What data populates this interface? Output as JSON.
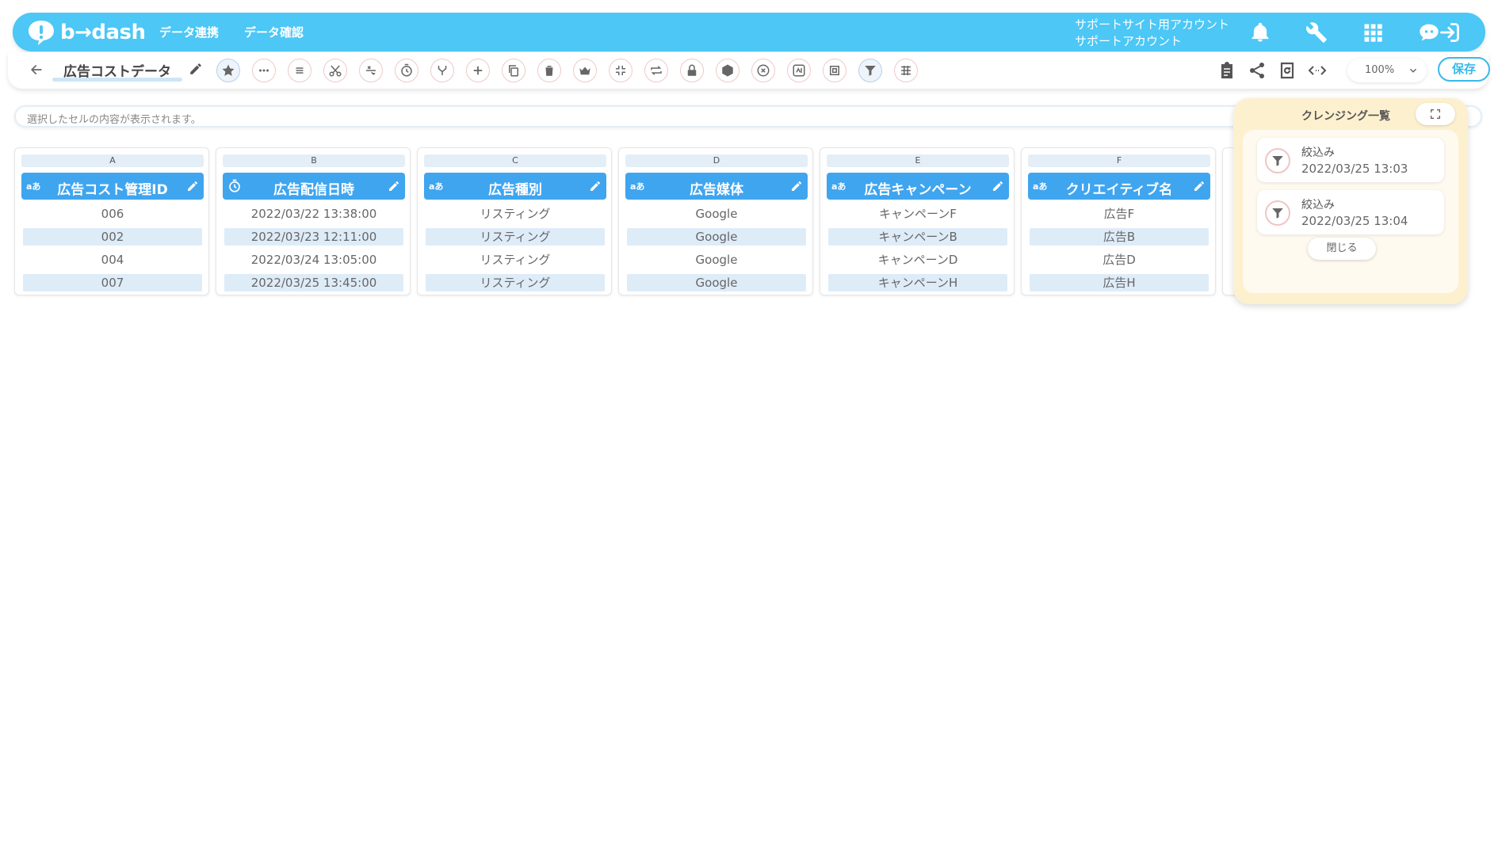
{
  "app": {
    "logo_text": "b→dash"
  },
  "header": {
    "nav": [
      {
        "label": "データ連携"
      },
      {
        "label": "データ確認"
      }
    ],
    "account_line1": "サポートサイト用アカウント",
    "account_line2": "サポートアカウント",
    "icons": [
      "bell-icon",
      "wrench-icon",
      "apps-grid-icon",
      "chat-icon",
      "logout-icon"
    ]
  },
  "toolbar": {
    "data_title": "広告コストデータ",
    "tools": [
      "star-icon",
      "ellipsis-icon",
      "list-icon",
      "scissors-icon",
      "formula-icon",
      "timer-icon",
      "merge-icon",
      "plus-icon",
      "copy-icon",
      "trash-icon",
      "crown-icon",
      "collapse-icon",
      "repeat-icon",
      "lock-icon",
      "package-icon",
      "cancel-icon",
      "replace-icon",
      "id-icon",
      "filter-icon",
      "pivot-icon"
    ],
    "right_icons": [
      "clipboard-icon",
      "share-icon",
      "refresh-icon",
      "code-icon"
    ],
    "zoom": "100%",
    "save_label": "保存"
  },
  "cellbar": {
    "placeholder": "選択したセルの内容が表示されます。"
  },
  "columns": [
    {
      "letter": "A",
      "type": "aあ",
      "name": "広告コスト管理ID",
      "cells": [
        "006",
        "002",
        "004",
        "007"
      ]
    },
    {
      "letter": "B",
      "type": "time",
      "name": "広告配信日時",
      "cells": [
        "2022/03/22 13:38:00",
        "2022/03/23 12:11:00",
        "2022/03/24 13:05:00",
        "2022/03/25 13:45:00"
      ]
    },
    {
      "letter": "C",
      "type": "aあ",
      "name": "広告種別",
      "cells": [
        "リスティング",
        "リスティング",
        "リスティング",
        "リスティング"
      ]
    },
    {
      "letter": "D",
      "type": "aあ",
      "name": "広告媒体",
      "cells": [
        "Google",
        "Google",
        "Google",
        "Google"
      ]
    },
    {
      "letter": "E",
      "type": "aあ",
      "name": "広告キャンペーン",
      "cells": [
        "キャンペーンF",
        "キャンペーンB",
        "キャンペーンD",
        "キャンペーンH"
      ]
    },
    {
      "letter": "F",
      "type": "aあ",
      "name": "クリエイティブ名",
      "cells": [
        "広告F",
        "広告B",
        "広告D",
        "広告H"
      ]
    }
  ],
  "cleansing_panel": {
    "title": "クレンジング一覧",
    "items": [
      {
        "label": "絞込み",
        "time": "2022/03/25 13:03"
      },
      {
        "label": "絞込み",
        "time": "2022/03/25 13:04"
      }
    ],
    "close_label": "閉じる"
  },
  "colors": {
    "header_bg": "#4cc7f6",
    "column_header": "#3fa5ef",
    "row_alt": "#deecf8",
    "panel_bg": "#fdf0cf",
    "accent": "#38b9ea"
  }
}
